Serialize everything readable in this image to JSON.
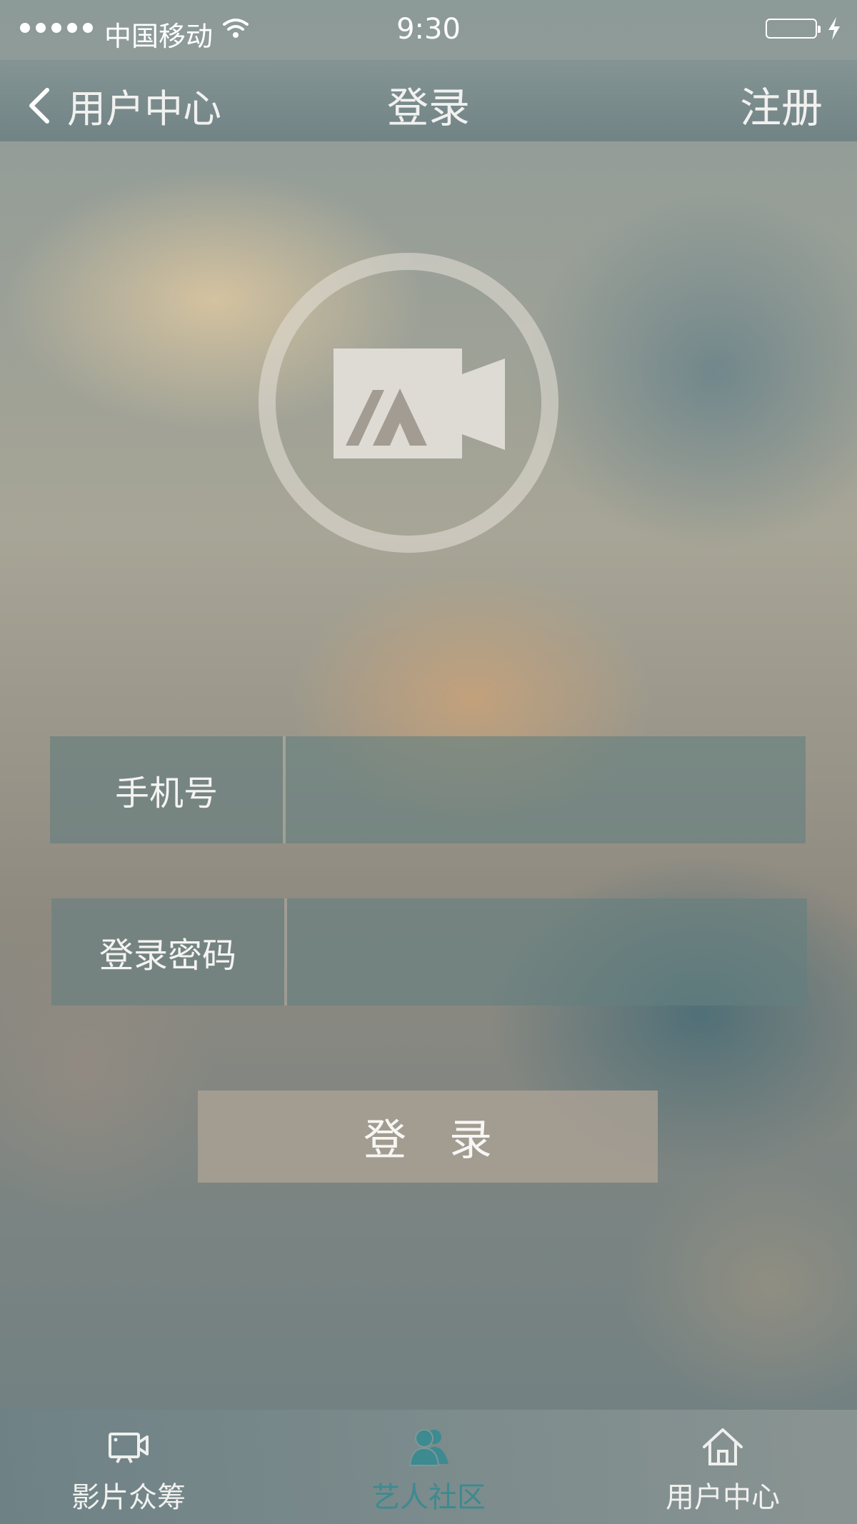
{
  "status_bar": {
    "carrier": "中国移动",
    "time": "9:30"
  },
  "nav": {
    "back_label": "用户中心",
    "title": "登录",
    "right_action": "注册"
  },
  "form": {
    "phone_label": "手机号",
    "phone_value": "",
    "password_label": "登录密码",
    "password_value": "",
    "submit_label": "登录"
  },
  "tabs": [
    {
      "label": "影片众筹",
      "icon": "video-icon",
      "active": false
    },
    {
      "label": "艺人社区",
      "icon": "users-icon",
      "active": true
    },
    {
      "label": "用户中心",
      "icon": "home-icon",
      "active": false
    }
  ],
  "colors": {
    "active_tab": "#3d8a90",
    "text": "#f1f1ef"
  }
}
